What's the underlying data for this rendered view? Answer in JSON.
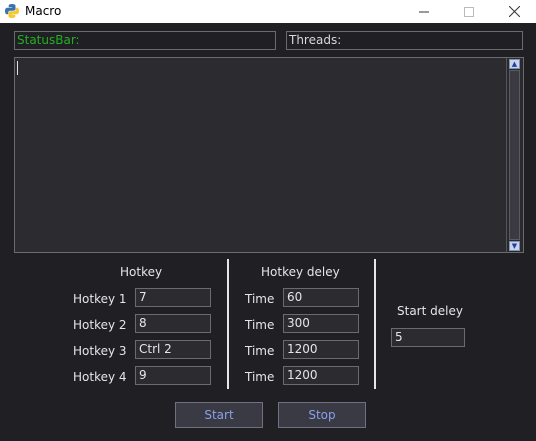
{
  "window": {
    "title": "Macro",
    "icon": "python-icon",
    "controls": [
      "minimize",
      "maximize",
      "close"
    ]
  },
  "status": {
    "text": "StatusBar:",
    "color": "#22b022"
  },
  "threads": {
    "text": "Threads:"
  },
  "log": {
    "value": ""
  },
  "hotkey": {
    "title": "Hotkey",
    "rows": [
      {
        "label": "Hotkey 1",
        "value": "7"
      },
      {
        "label": "Hotkey 2",
        "value": "8"
      },
      {
        "label": "Hotkey 3",
        "value": "Ctrl 2"
      },
      {
        "label": "Hotkey 4",
        "value": "9"
      }
    ]
  },
  "hotkey_delay": {
    "title": "Hotkey deley",
    "rows": [
      {
        "label": "Time",
        "value": "60"
      },
      {
        "label": "Time",
        "value": "300"
      },
      {
        "label": "Time",
        "value": "1200"
      },
      {
        "label": "Time",
        "value": "1200"
      }
    ]
  },
  "start_delay": {
    "title": "Start deley",
    "value": "5"
  },
  "buttons": {
    "start": "Start",
    "stop": "Stop"
  }
}
